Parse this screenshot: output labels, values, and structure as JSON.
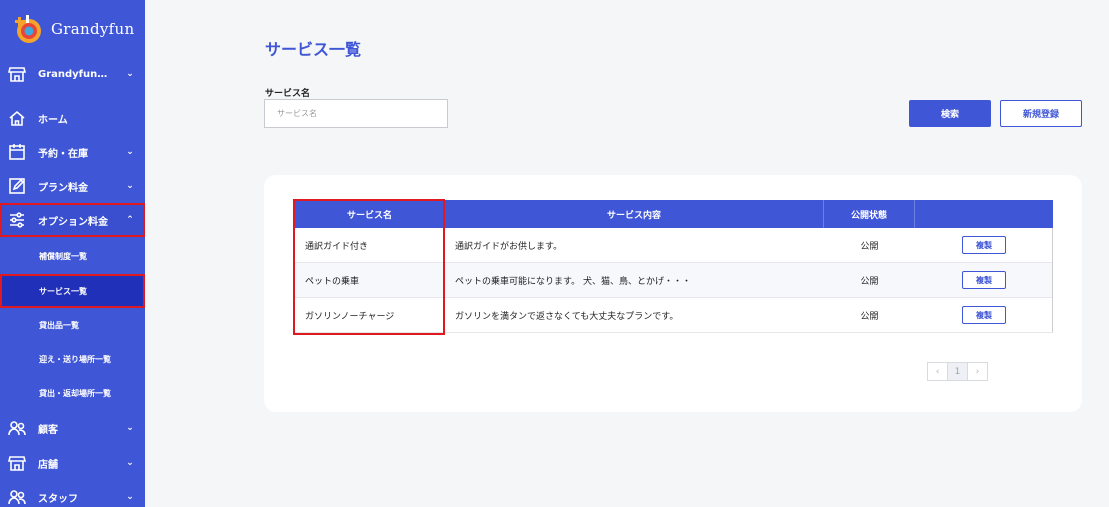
{
  "app": {
    "name": "Grandyfun"
  },
  "sidebar": {
    "store": {
      "label": "Grandyfun…"
    },
    "items": [
      {
        "label": "ホーム",
        "icon": "home-icon"
      },
      {
        "label": "予約・在庫",
        "icon": "calendar-icon"
      },
      {
        "label": "プラン料金",
        "icon": "edit-icon"
      },
      {
        "label": "オプション料金",
        "icon": "sliders-icon"
      },
      {
        "label": "顧客",
        "icon": "users-icon"
      },
      {
        "label": "店舗",
        "icon": "store-icon"
      },
      {
        "label": "スタッフ",
        "icon": "staff-icon"
      }
    ],
    "subitems": [
      {
        "label": "補償制度一覧"
      },
      {
        "label": "サービス一覧"
      },
      {
        "label": "貸出品一覧"
      },
      {
        "label": "迎え・送り場所一覧"
      },
      {
        "label": "貸出・返却場所一覧"
      }
    ]
  },
  "main": {
    "title": "サービス一覧",
    "search": {
      "label": "サービス名",
      "placeholder": "サービス名",
      "value": ""
    },
    "buttons": {
      "search": "検索",
      "new": "新規登録"
    }
  },
  "table": {
    "headers": [
      "サービス名",
      "サービス内容",
      "公開状態",
      ""
    ],
    "rows": [
      {
        "name": "通訳ガイド付き",
        "description": "通訳ガイドがお供します。",
        "status": "公開",
        "action": "複製"
      },
      {
        "name": "ペットの乗車",
        "description": "ペットの乗車可能になります。 犬、猫、鳥、とかげ・・・",
        "status": "公開",
        "action": "複製"
      },
      {
        "name": "ガソリンノーチャージ",
        "description": "ガソリンを満タンで返さなくても大丈夫なプランです。",
        "status": "公開",
        "action": "複製"
      }
    ]
  },
  "pagination": {
    "prev": "‹",
    "current": "1",
    "next": "›"
  },
  "colors": {
    "primary": "#3f56d6",
    "highlight": "#e0181f",
    "background": "#f5f6f8"
  }
}
